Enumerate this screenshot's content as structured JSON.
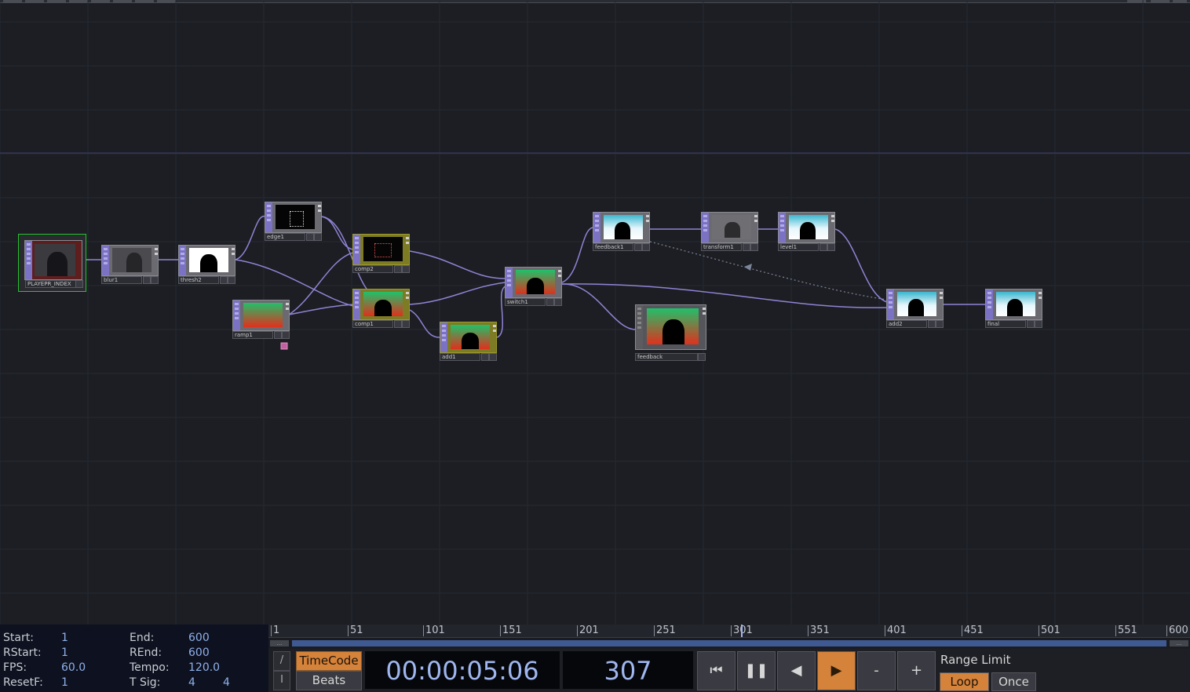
{
  "nodes": [
    {
      "id": "player",
      "label": "PLAYEPR_INDEX",
      "thumb": "dark",
      "selected": true
    },
    {
      "id": "blur",
      "label": "blur1",
      "thumb": "grey"
    },
    {
      "id": "thresh",
      "label": "thresh2",
      "thumb": "silo"
    },
    {
      "id": "edge",
      "label": "edge1",
      "thumb": "edge"
    },
    {
      "id": "ramp",
      "label": "ramp1",
      "thumb": "ramp"
    },
    {
      "id": "comp2",
      "label": "comp2",
      "thumb": "edge",
      "yellow": true
    },
    {
      "id": "comp1",
      "label": "comp1",
      "thumb": "green",
      "yellow": true
    },
    {
      "id": "add1",
      "label": "add1",
      "thumb": "green",
      "yellow": true
    },
    {
      "id": "switch",
      "label": "switch1",
      "thumb": "green"
    },
    {
      "id": "feedback",
      "label": "feedback",
      "thumb": "green"
    },
    {
      "id": "feedback1",
      "label": "feedback1",
      "thumb": "cyan"
    },
    {
      "id": "transform",
      "label": "transform1",
      "thumb": "grey"
    },
    {
      "id": "level",
      "label": "level1",
      "thumb": "cyan"
    },
    {
      "id": "add2",
      "label": "add2",
      "thumb": "cyan"
    },
    {
      "id": "final",
      "label": "final",
      "thumb": "cyan"
    }
  ],
  "info": {
    "start_label": "Start:",
    "start": "1",
    "end_label": "End:",
    "end": "600",
    "rstart_label": "RStart:",
    "rstart": "1",
    "rend_label": "REnd:",
    "rend": "600",
    "fps_label": "FPS:",
    "fps": "60.0",
    "tempo_label": "Tempo:",
    "tempo": "120.0",
    "resetf_label": "ResetF:",
    "resetf": "1",
    "tsig_label": "T Sig:",
    "tsig_a": "4",
    "tsig_b": "4"
  },
  "ruler": [
    "1",
    "51",
    "101",
    "151",
    "201",
    "251",
    "301",
    "351",
    "401",
    "451",
    "501",
    "551",
    "600"
  ],
  "scroll": {
    "left": "...",
    "right": "..."
  },
  "controls": {
    "slash": "/",
    "bar": "I",
    "timecode": "TimeCode",
    "beats": "Beats",
    "time": "00:00:05:06",
    "frame": "307",
    "minus": "-",
    "plus": "+",
    "range_limit": "Range Limit",
    "loop": "Loop",
    "once": "Once"
  },
  "colors": {
    "accent": "#d5823a",
    "wire": "#8f83d4",
    "selected": "#26c12c",
    "time_text": "#9fb6ef"
  }
}
